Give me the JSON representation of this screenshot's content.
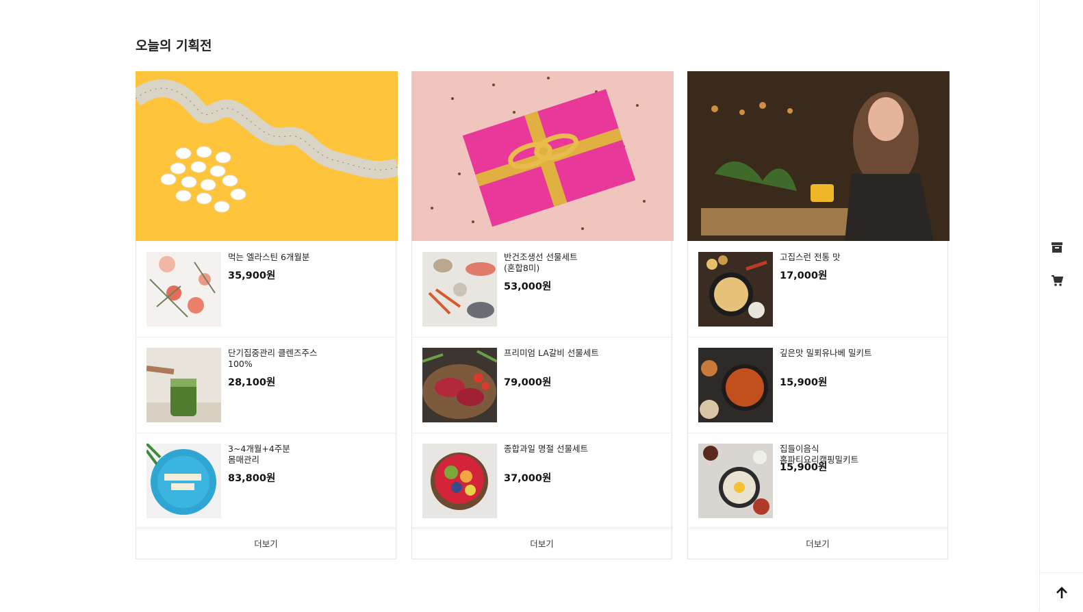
{
  "section": {
    "title": "오늘의 기획전"
  },
  "cards": [
    {
      "banner_icon": "tape-measure-pills-image",
      "items": [
        {
          "name": "먹는 엘라스틴 6개월분",
          "price": "35,900원",
          "thumb_icon": "grapefruit-herbs-image"
        },
        {
          "name": "단기집중관리 클렌즈주스 100%",
          "price": "28,100원",
          "thumb_icon": "green-juice-image"
        },
        {
          "name": "3~4개월+4주분 몸매관리",
          "price": "83,800원",
          "thumb_icon": "weight-loss-plate-image"
        }
      ],
      "more_label": "더보기"
    },
    {
      "banner_icon": "gift-box-image",
      "items": [
        {
          "name": "반건조생선 선물세트(혼합8미)",
          "price": "53,000원",
          "thumb_icon": "seafood-image"
        },
        {
          "name": "프리미엄 LA갈비 선물세트",
          "price": "79,000원",
          "thumb_icon": "raw-meat-board-image"
        },
        {
          "name": "종합과일 명절 선물세트",
          "price": "37,000원",
          "thumb_icon": "fruit-bowl-image"
        }
      ],
      "more_label": "더보기"
    },
    {
      "banner_icon": "woman-dining-image",
      "items": [
        {
          "name": "고집스런 전통 맛",
          "price": "17,000원",
          "thumb_icon": "stew-pot-image"
        },
        {
          "name": "깊은맛 밀푀유나베 밀키트",
          "price": "15,900원",
          "thumb_icon": "noodle-soup-image"
        },
        {
          "name": "집들이음식 홈파티요리캠핑밀키트",
          "price": "15,900원",
          "thumb_icon": "bibimbap-image"
        }
      ],
      "more_label": "더보기"
    }
  ],
  "sidebar": {
    "archive_icon": "archive-box-icon",
    "cart_icon": "shopping-cart-icon",
    "top_icon": "arrow-up-icon"
  },
  "colors": {
    "banner1_bg": "#fdc43c",
    "banner2_bg": "#f0c5bd",
    "banner3_bg": "#3a2a1c",
    "text": "#222222",
    "border": "#e3e3e3"
  }
}
